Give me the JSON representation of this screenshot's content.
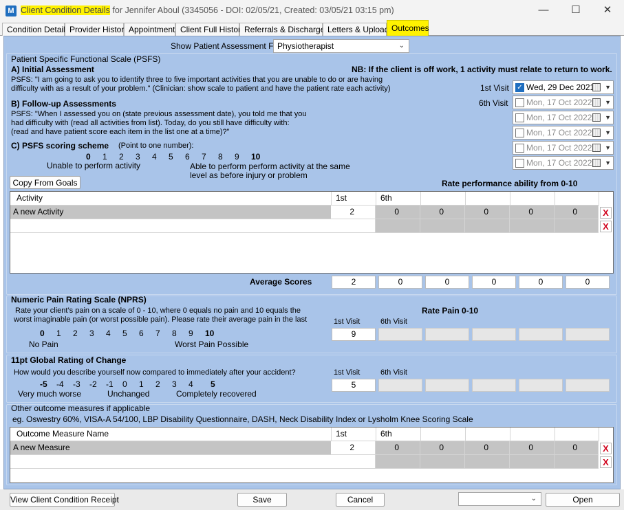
{
  "window": {
    "title_highlight": "Client Condition Details",
    "title_rest": "for Jennifer Aboul  (3345056 - DOI: 02/05/21, Created: 03/05/21 03:15 pm)",
    "app_icon": "M",
    "minimize": "—",
    "maximize": "☐",
    "close": "✕"
  },
  "tabs": [
    "Condition Details",
    "Provider History",
    "Appointments",
    "Client Full History",
    "Referrals & Discharges",
    "Letters & Uploads",
    "Outcomes"
  ],
  "assessment": {
    "label": "Show Patient Assessment For",
    "value": "Physiotherapist"
  },
  "psfs": {
    "heading": "Patient Specific Functional Scale (PSFS)",
    "a_title": "A) Initial Assessment",
    "nb": "NB: If the client is off work, 1 activity must relate to return to work.",
    "a_text1": "PSFS: \"I am going to ask you to identify three to five important activities that you are unable to do or are having",
    "a_text2": "difficulty with as a result of your problem.\" (Clinician: show scale to patient and have the patient rate each activity)",
    "b_title": "B) Follow-up Assessments",
    "b_text1": "PSFS: \"When I assessed you on (state previous assessment date), you told me that you",
    "b_text2": "had difficulty with (read all activities from list).  Today, do you still have difficulty with:",
    "b_text3": "(read and have patient score each item in the list one at a time)?\"",
    "c_title": "C) PSFS scoring scheme",
    "c_note": "(Point to one number):",
    "scale": [
      "0",
      "1",
      "2",
      "3",
      "4",
      "5",
      "6",
      "7",
      "8",
      "9",
      "10"
    ],
    "scale_low": "Unable to perform activity",
    "scale_high1": "Able to perform perform activity at the same",
    "scale_high2": "level as before injury or problem",
    "visit1_label": "1st Visit",
    "visit6_label": "6th Visit",
    "dates": [
      {
        "text": "Wed, 29 Dec 2021",
        "checked": true
      },
      {
        "text": "Mon, 17 Oct  2022",
        "checked": false
      },
      {
        "text": "Mon, 17 Oct  2022",
        "checked": false
      },
      {
        "text": "Mon, 17 Oct  2022",
        "checked": false
      },
      {
        "text": "Mon, 17 Oct  2022",
        "checked": false
      },
      {
        "text": "Mon, 17 Oct  2022",
        "checked": false
      }
    ],
    "copy_button": "Copy From Goals",
    "rate_label": "Rate performance ability from  0-10",
    "grid_headers": [
      "Activity",
      "1st",
      "6th",
      "",
      "",
      "",
      "",
      ""
    ],
    "rows": [
      {
        "name": "A new Activity",
        "first": "2",
        "others": [
          "0",
          "0",
          "0",
          "0",
          "0"
        ]
      },
      {
        "name": "",
        "first": "",
        "others": [
          "",
          "",
          "",
          "",
          ""
        ]
      }
    ],
    "delete_glyph": "X",
    "avg_label": "Average Scores",
    "avg_values": [
      "2",
      "0",
      "0",
      "0",
      "0",
      "0"
    ]
  },
  "nprs": {
    "heading": "Numeric Pain Rating Scale (NPRS)",
    "text1": "Rate your client’s pain on a scale of 0 - 10, where 0 equals no pain and 10 equals the",
    "text2": "worst imaginable pain (or worst possible pain). Please rate their average pain in the last",
    "scale": [
      "0",
      "1",
      "2",
      "3",
      "4",
      "5",
      "6",
      "7",
      "8",
      "9",
      "10"
    ],
    "low": "No Pain",
    "high": "Worst Pain Possible",
    "rate_label": "Rate Pain 0-10",
    "visit1_label": "1st Visit",
    "visit6_label": "6th Visit",
    "values": [
      "9",
      "",
      "",
      "",
      "",
      ""
    ]
  },
  "grc": {
    "heading": "11pt Global Rating of Change",
    "text": "How would you describe yourself now compared to immediately after your accident?",
    "scale": [
      "-5",
      "-4",
      "-3",
      "-2",
      "-1",
      "0",
      "1",
      "2",
      "3",
      "4",
      "5"
    ],
    "low": "Very much worse",
    "mid": "Unchanged",
    "high": "Completely recovered",
    "visit1_label": "1st Visit",
    "visit6_label": "6th Visit",
    "values": [
      "5",
      "",
      "",
      "",
      "",
      ""
    ]
  },
  "other": {
    "heading": "Other outcome measures if applicable",
    "example": "eg. Oswestry 60%, VISA-A 54/100, LBP Disability Questionnaire, DASH, Neck Disability Index or Lysholm Knee Scoring Scale",
    "grid_headers": [
      "Outcome Measure Name",
      "1st",
      "6th",
      "",
      "",
      "",
      "",
      ""
    ],
    "rows": [
      {
        "name": "A new Measure",
        "first": "2",
        "others": [
          "0",
          "0",
          "0",
          "0",
          "0"
        ]
      },
      {
        "name": "",
        "first": "",
        "others": [
          "",
          "",
          "",
          "",
          ""
        ]
      }
    ]
  },
  "footer": {
    "receipt_button": "View Client Condition Receipt",
    "save_button": "Save",
    "cancel_button": "Cancel",
    "open_select": "",
    "open_button": "Open"
  }
}
